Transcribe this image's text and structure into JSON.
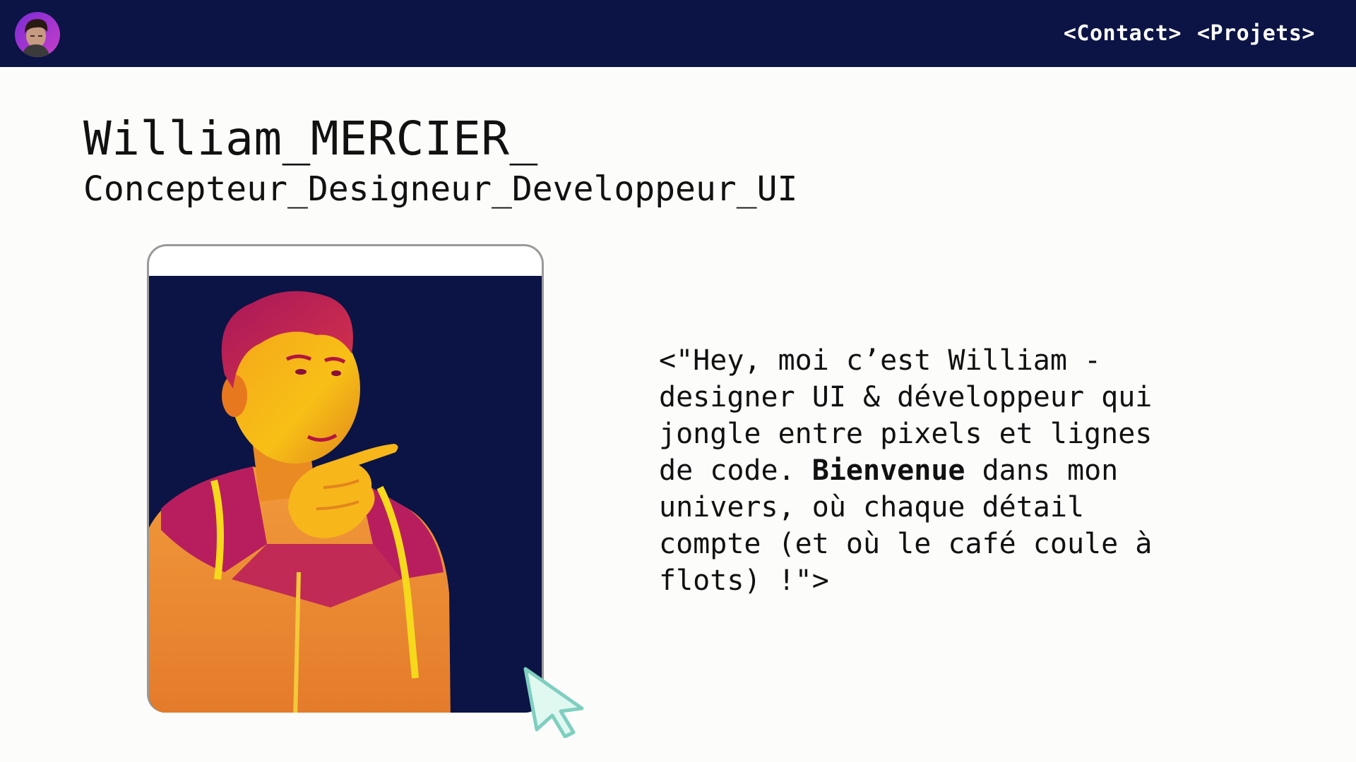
{
  "header": {
    "nav": {
      "contact": "<Contact>",
      "projets": "<Projets>"
    }
  },
  "hero": {
    "name": "William_MERCIER_",
    "role": "Concepteur_Designeur_Developpeur_UI"
  },
  "intro": {
    "line1": "<\"Hey, moi c’est William -\ndesigner UI & développeur qui\njongle entre pixels et lignes\nde code. ",
    "emphasis": "Bienvenue",
    "line2": " dans mon\nunivers, où chaque détail\ncompte (et où le café coule à\nflots) !\">"
  },
  "icons": {
    "avatar": "avatar-photo",
    "cursor": "cursor-arrow-icon"
  },
  "colors": {
    "header_bg": "#0b1444",
    "photo_bg": "#0b1444",
    "text": "#111111",
    "cursor_fill": "#dff8f0",
    "cursor_stroke": "#7fcfc0"
  }
}
